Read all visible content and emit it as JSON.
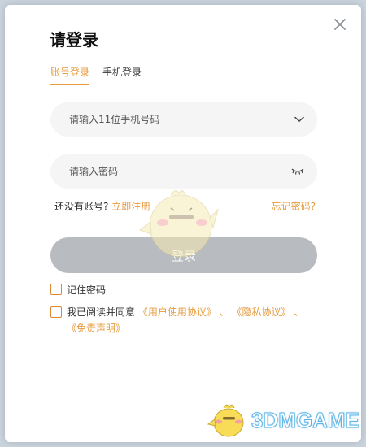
{
  "dialog": {
    "title": "请登录"
  },
  "tabs": [
    {
      "label": "账号登录",
      "active": true
    },
    {
      "label": "手机登录",
      "active": false
    }
  ],
  "phone": {
    "placeholder": "请输入11位手机号码",
    "value": ""
  },
  "password": {
    "placeholder": "请输入密码",
    "value": ""
  },
  "signup": {
    "prompt": "还没有账号?",
    "link": "立即注册"
  },
  "forgot": {
    "link": "忘记密码?"
  },
  "login_button": {
    "label": "登录"
  },
  "remember": {
    "label": "记住密码",
    "checked": false
  },
  "agreement": {
    "prefix": "我已阅读并同意",
    "user_agreement": "《用户使用协议》",
    "sep1": "、",
    "privacy": "《隐私协议》",
    "sep2": "、",
    "disclaimer": "《免责声明》",
    "checked": false
  },
  "watermark": {
    "text": "3DMGAME"
  },
  "colors": {
    "accent": "#e79a3c",
    "button_disabled": "#b8bbc0",
    "field_bg": "#f5f5f6"
  }
}
